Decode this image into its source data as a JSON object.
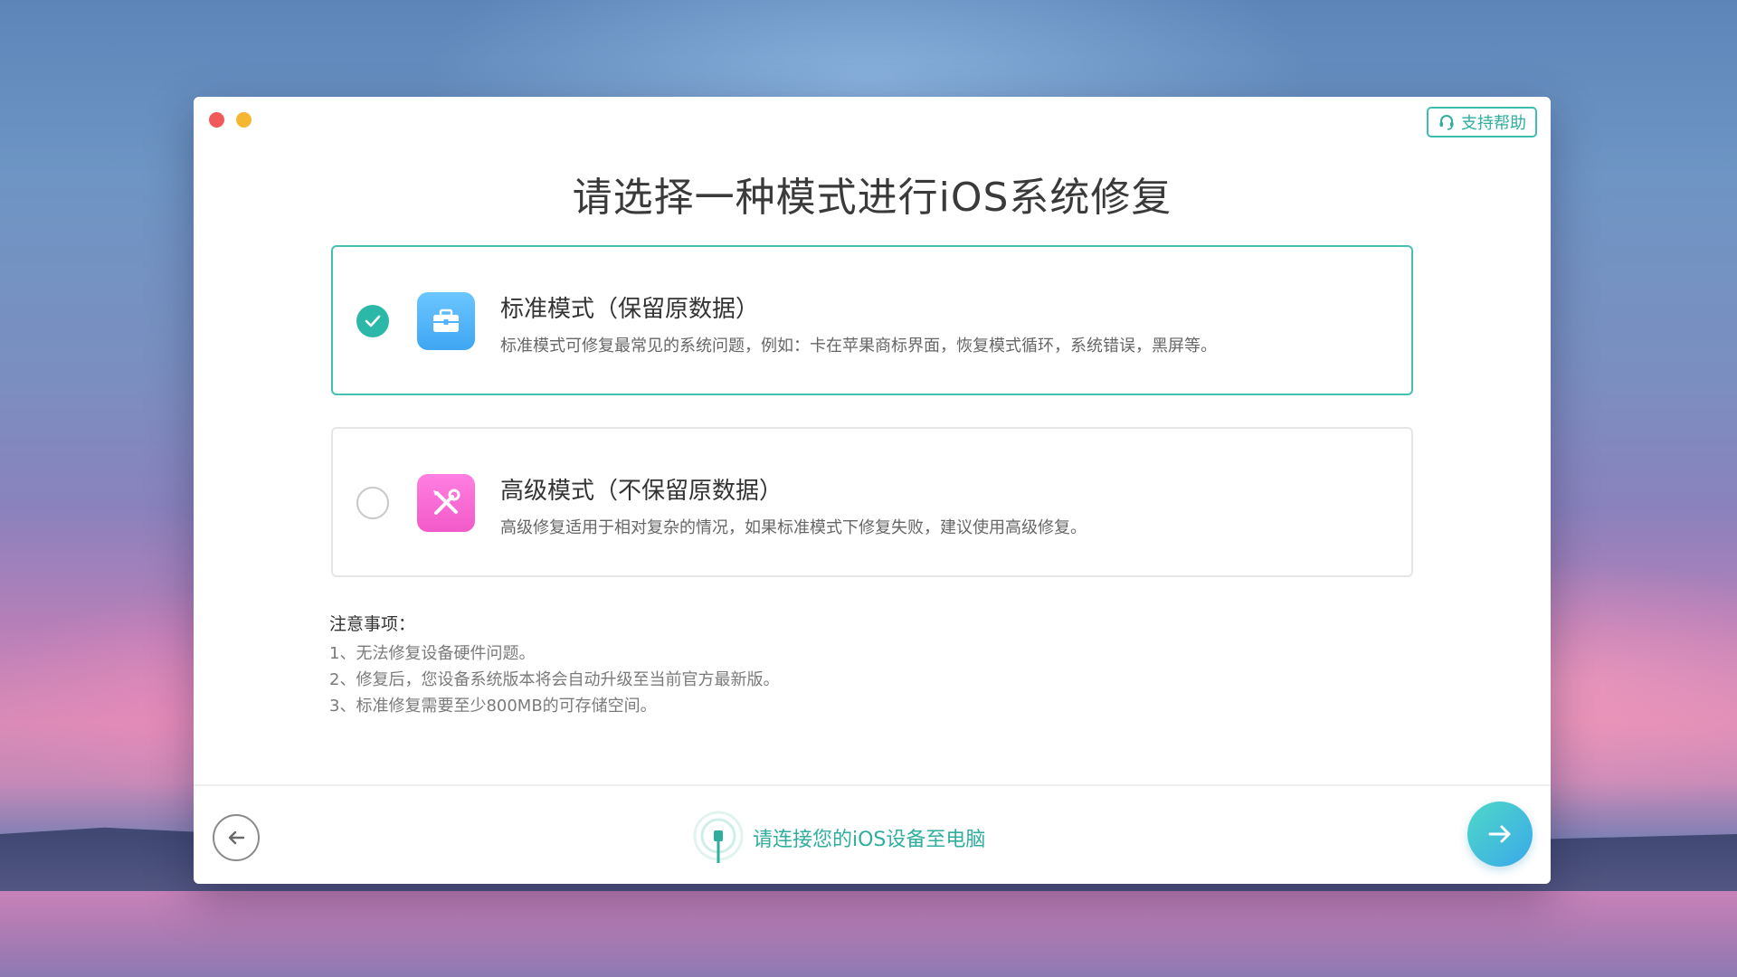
{
  "window": {
    "title": "请选择一种模式进行iOS系统修复",
    "help_label": "支持帮助"
  },
  "options": [
    {
      "title": "标准模式（保留原数据）",
      "description": "标准模式可修复最常见的系统问题，例如：卡在苹果商标界面，恢复模式循环，系统错误，黑屏等。",
      "selected": true,
      "icon": "toolbox-icon"
    },
    {
      "title": "高级模式（不保留原数据）",
      "description": "高级修复适用于相对复杂的情况，如果标准模式下修复失败，建议使用高级修复。",
      "selected": false,
      "icon": "tools-icon"
    }
  ],
  "notes": {
    "title": "注意事项：",
    "items": [
      "1、无法修复设备硬件问题。",
      "2、修复后，您设备系统版本将会自动升级至当前官方最新版。",
      "3、标准修复需要至少800MB的可存储空间。"
    ]
  },
  "footer": {
    "connect_text": "请连接您的iOS设备至电脑"
  },
  "colors": {
    "accent": "#2fae9e",
    "selected_border": "#46c0b1",
    "close": "#f15a5a",
    "minimize": "#f5b731"
  }
}
